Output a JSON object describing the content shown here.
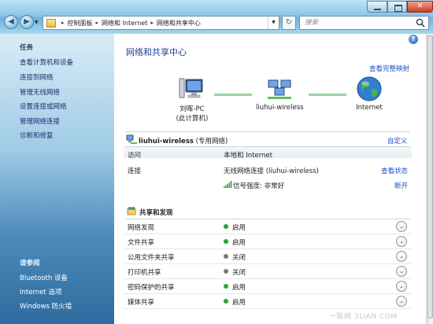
{
  "addressbar": {
    "crumbs": [
      "控制面板",
      "网络和 Internet",
      "网络和共享中心"
    ],
    "search_placeholder": "搜索"
  },
  "sidebar": {
    "tasks_header": "任务",
    "tasks": [
      "查看计算机和设备",
      "连接到网络",
      "管理无线网络",
      "设置连接或网络",
      "管理网络连接",
      "诊断和修复"
    ],
    "see_also_header": "请参阅",
    "see_also": [
      "Bluetooth 设备",
      "Internet 选项",
      "Windows 防火墙"
    ]
  },
  "main": {
    "title": "网络和共享中心",
    "full_map_link": "查看完整映射",
    "map": {
      "pc_label_line1": "刘晖-PC",
      "pc_label_line2": "(此计算机)",
      "network_label": "liuhui-wireless",
      "internet_label": "Internet"
    },
    "network": {
      "name": "liuhui-wireless",
      "type": "(专用网络)",
      "customize_link": "自定义",
      "rows": [
        {
          "label": "访问",
          "value": "本地和 Internet"
        },
        {
          "label": "连接",
          "value": "无线网络连接 (liuhui-wireless)",
          "action": "查看状态"
        }
      ],
      "signal_label": "信号强度:",
      "signal_value": "非常好",
      "disconnect_link": "断开"
    },
    "sharing": {
      "title": "共享和发现",
      "rows": [
        {
          "label": "网络发现",
          "state": "启用"
        },
        {
          "label": "文件共享",
          "state": "启用"
        },
        {
          "label": "公用文件夹共享",
          "state": "关闭"
        },
        {
          "label": "打印机共享",
          "state": "关闭"
        },
        {
          "label": "密码保护的共享",
          "state": "启用"
        },
        {
          "label": "媒体共享",
          "state": "启用"
        }
      ]
    }
  },
  "colors": {
    "on": "#29a33c",
    "off": "#7a7a7a",
    "link": "#1a4cc8",
    "title": "#1f3f8e"
  },
  "watermark": "一联网 3LIAN.COM"
}
